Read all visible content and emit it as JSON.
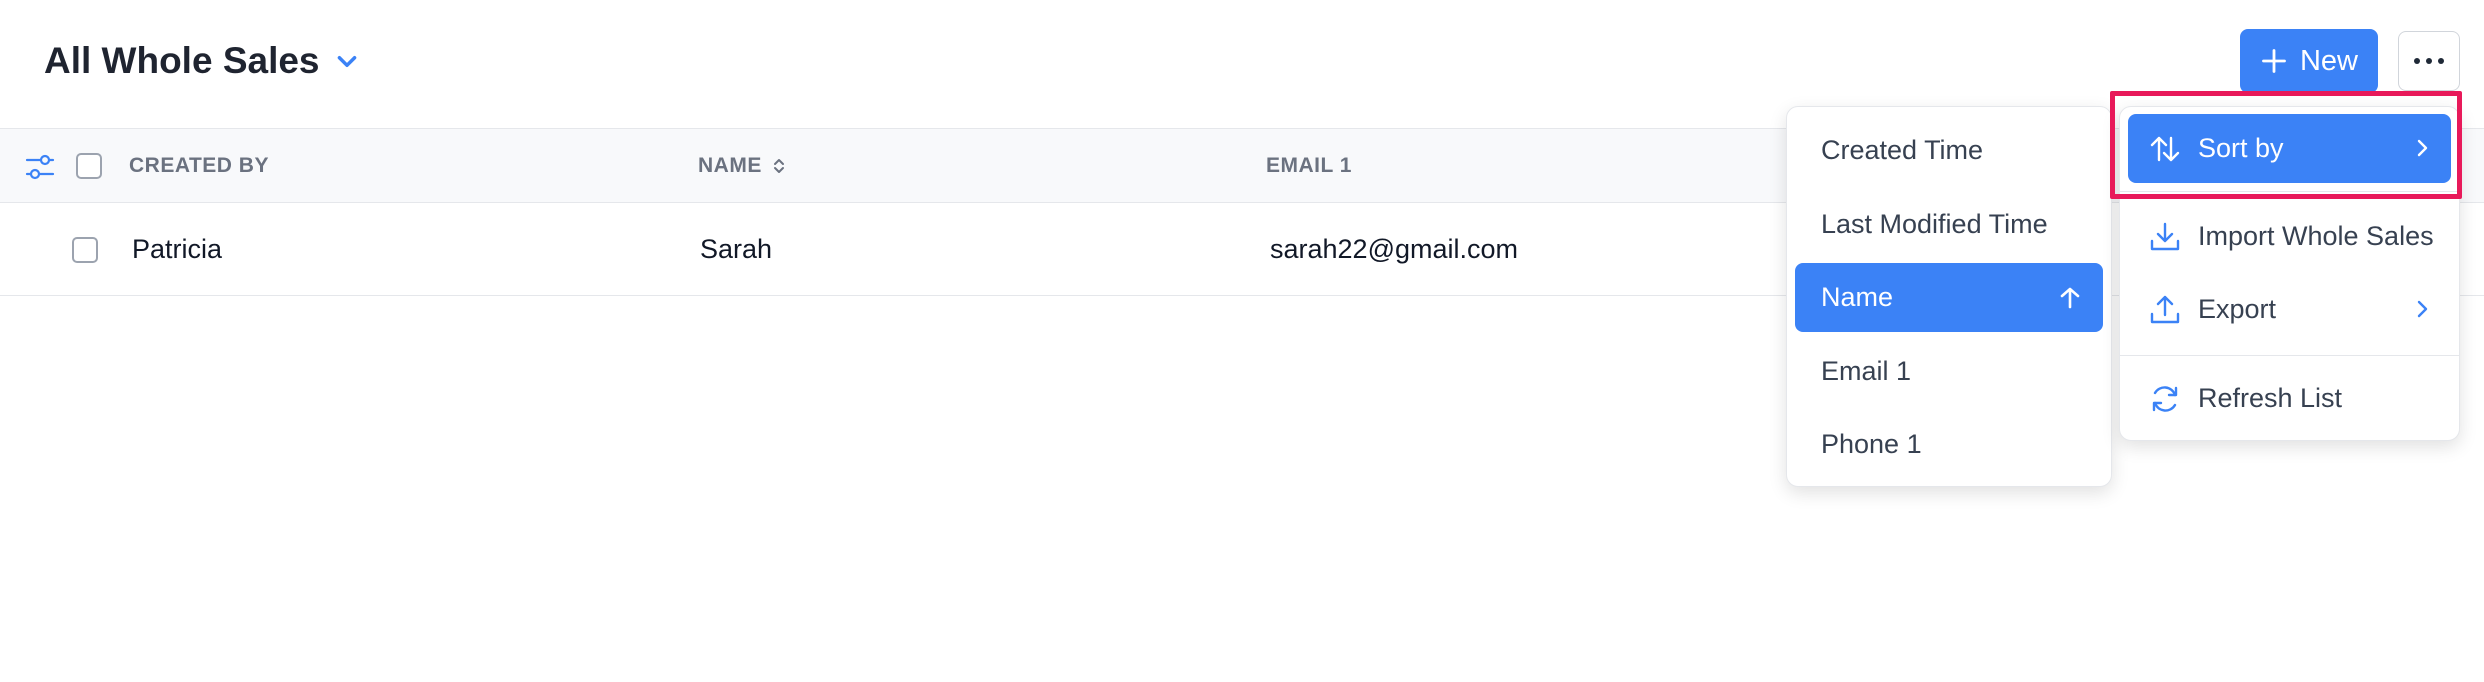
{
  "header": {
    "title": "All Whole Sales",
    "new_button": "New"
  },
  "table": {
    "columns": [
      "CREATED BY",
      "NAME",
      "EMAIL 1"
    ],
    "rows": [
      {
        "created_by": "Patricia",
        "name": "Sarah",
        "email": "sarah22@gmail.com"
      }
    ]
  },
  "sort_menu": {
    "items": [
      "Created Time",
      "Last Modified Time",
      "Name",
      "Email 1",
      "Phone 1"
    ],
    "selected": "Name",
    "direction": "ascending"
  },
  "more_menu": {
    "sort_by": "Sort by",
    "import": "Import Whole Sales",
    "export": "Export",
    "refresh": "Refresh List"
  },
  "colors": {
    "accent": "#3b82f6",
    "highlight": "#e8195a"
  },
  "icons": {
    "title_dropdown": "chevron-down-icon",
    "new": "plus-icon",
    "more": "ellipsis-icon",
    "filter": "sliders-icon",
    "sort_indicator": "sort-icon",
    "sort_selected": "arrow-up-icon",
    "sort_by": "sort-arrows-icon",
    "import": "download-icon",
    "export": "upload-icon",
    "refresh": "refresh-icon",
    "submenu": "chevron-right-icon"
  }
}
